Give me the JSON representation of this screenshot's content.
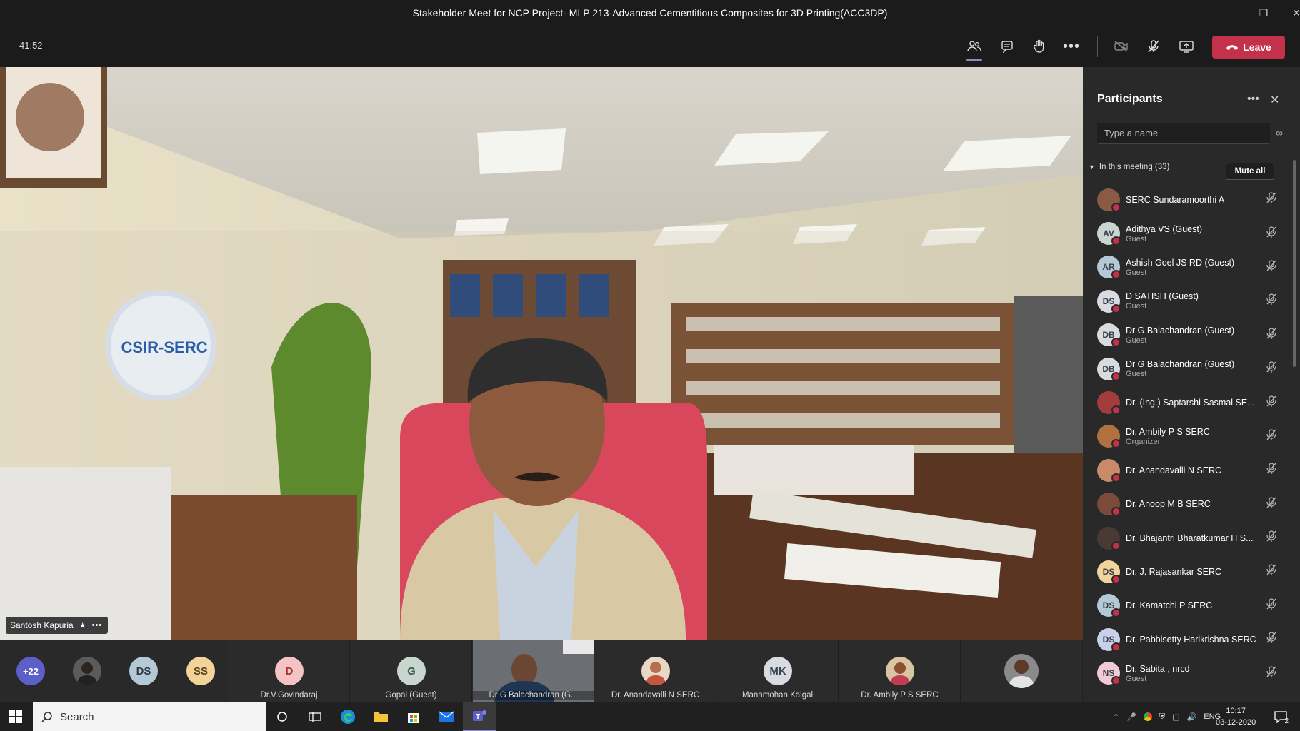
{
  "window": {
    "title": "Stakeholder Meet for NCP Project- MLP 213-Advanced Cementitious Composites for 3D Printing(ACC3DP)"
  },
  "toolbar": {
    "timer": "41:52",
    "leave_label": "Leave"
  },
  "video": {
    "speaker_name": "Santosh Kapuria",
    "logo_text": "CSIR-SERC"
  },
  "strip": {
    "more_count": "+22",
    "bubbles": [
      {
        "initials": "DS",
        "color": "#b5c8d6"
      },
      {
        "initials": "SS",
        "color": "#f2d49a"
      }
    ],
    "tiles": [
      {
        "initials": "D",
        "name": "Dr.V.Govindaraj",
        "color": "#f4c4c4"
      },
      {
        "initials": "G",
        "name": "Gopal (Guest)",
        "color": "#c9d6cf"
      },
      {
        "initials": "",
        "name": "Dr G Balachandran (G...",
        "color": "#555"
      },
      {
        "initials": "",
        "name": "Dr. Anandavalli N SERC",
        "color": "#c98a6a"
      },
      {
        "initials": "MK",
        "name": "Manamohan Kalgal",
        "color": "#d8dbe0"
      },
      {
        "initials": "",
        "name": "Dr. Ambily P S SERC",
        "color": "#b0713f"
      }
    ]
  },
  "panel": {
    "title": "Participants",
    "search_placeholder": "Type a name",
    "section_label": "In this meeting (33)",
    "mute_all_label": "Mute all",
    "participants": [
      {
        "initials": "",
        "name": "SERC Sundaramoorthi A",
        "role": "",
        "color": "#8a5a44"
      },
      {
        "initials": "AV",
        "name": "Adithya VS (Guest)",
        "role": "Guest",
        "color": "#c9d6cf"
      },
      {
        "initials": "AR",
        "name": "Ashish Goel JS RD (Guest)",
        "role": "Guest",
        "color": "#b5c8d6"
      },
      {
        "initials": "DS",
        "name": "D SATISH (Guest)",
        "role": "Guest",
        "color": "#d8dbe0"
      },
      {
        "initials": "DB",
        "name": "Dr G Balachandran (Guest)",
        "role": "Guest",
        "color": "#d8dbe0"
      },
      {
        "initials": "DB",
        "name": "Dr G Balachandran (Guest)",
        "role": "Guest",
        "color": "#d8dbe0"
      },
      {
        "initials": "",
        "name": "Dr. (Ing.) Saptarshi Sasmal SE...",
        "role": "",
        "color": "#a33d3d"
      },
      {
        "initials": "",
        "name": "Dr. Ambily P S SERC",
        "role": "Organizer",
        "color": "#b0713f"
      },
      {
        "initials": "",
        "name": "Dr. Anandavalli N SERC",
        "role": "",
        "color": "#c98a6a"
      },
      {
        "initials": "",
        "name": "Dr. Anoop M B SERC",
        "role": "",
        "color": "#7a4a3a"
      },
      {
        "initials": "",
        "name": "Dr. Bhajantri Bharatkumar H S...",
        "role": "",
        "color": "#4a3a34"
      },
      {
        "initials": "DS",
        "name": "Dr. J. Rajasankar SERC",
        "role": "",
        "color": "#f2d49a"
      },
      {
        "initials": "DS",
        "name": "Dr. Kamatchi P SERC",
        "role": "",
        "color": "#b5c8d6"
      },
      {
        "initials": "DS",
        "name": "Dr. Pabbisetty Harikrishna SERC",
        "role": "",
        "color": "#c9d0ea"
      },
      {
        "initials": "NS",
        "name": "Dr. Sabita , nrcd",
        "role": "Guest",
        "color": "#f2c9d6"
      }
    ]
  },
  "taskbar": {
    "search_label": "Search",
    "lang": "ENG",
    "time": "10:17",
    "date": "03-12-2020",
    "notif_count": "2"
  }
}
